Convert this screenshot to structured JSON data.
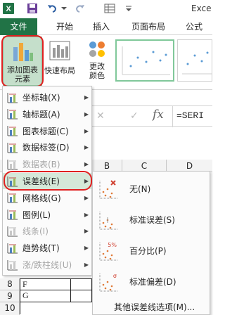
{
  "title_text": "Exce",
  "tabs": [
    {
      "label": "文件"
    },
    {
      "label": "开始"
    },
    {
      "label": "插入"
    },
    {
      "label": "页面布局"
    },
    {
      "label": "公式"
    }
  ],
  "ribbon": {
    "add_chart_element": {
      "line1": "添加图表",
      "line2": "元素"
    },
    "quick_layout": {
      "label": "快速布局"
    },
    "change_colors": {
      "line1": "更改",
      "line2": "颜色"
    }
  },
  "formula_bar": {
    "fx": "fx",
    "formula": "=SERI"
  },
  "columns": [
    "B",
    "C",
    "D"
  ],
  "rows": [
    {
      "num": "8",
      "a": "F"
    },
    {
      "num": "9",
      "a": "G"
    },
    {
      "num": "10",
      "a": ""
    }
  ],
  "menu": {
    "items": [
      {
        "label": "坐标轴(X)",
        "disabled": false,
        "icon": "axes-icon"
      },
      {
        "label": "轴标题(A)",
        "disabled": false,
        "icon": "axis-title-icon"
      },
      {
        "label": "图表标题(C)",
        "disabled": false,
        "icon": "chart-title-icon"
      },
      {
        "label": "数据标签(D)",
        "disabled": false,
        "icon": "data-labels-icon"
      },
      {
        "label": "数据表(B)",
        "disabled": true,
        "icon": "data-table-icon"
      },
      {
        "label": "误差线(E)",
        "disabled": false,
        "selected": true,
        "icon": "error-bars-icon"
      },
      {
        "label": "网格线(G)",
        "disabled": false,
        "icon": "gridlines-icon"
      },
      {
        "label": "图例(L)",
        "disabled": false,
        "icon": "legend-icon"
      },
      {
        "label": "线条(I)",
        "disabled": true,
        "icon": "lines-icon"
      },
      {
        "label": "趋势线(T)",
        "disabled": false,
        "icon": "trendline-icon"
      },
      {
        "label": "涨/跌柱线(U)",
        "disabled": true,
        "icon": "up-down-bars-icon"
      }
    ]
  },
  "submenu": {
    "items": [
      {
        "label": "无(N)",
        "icon": "none-error-icon"
      },
      {
        "label": "标准误差(S)",
        "icon": "standard-error-icon"
      },
      {
        "label": "百分比(P)",
        "icon": "percentage-icon",
        "badge": "5%"
      },
      {
        "label": "标准偏差(D)",
        "icon": "standard-deviation-icon",
        "badge": "σ"
      }
    ],
    "more": "其他误差线选项(M)..."
  },
  "colors": {
    "accent": "#217346",
    "highlight": "#d5e8d9",
    "annotation": "#e02020"
  }
}
